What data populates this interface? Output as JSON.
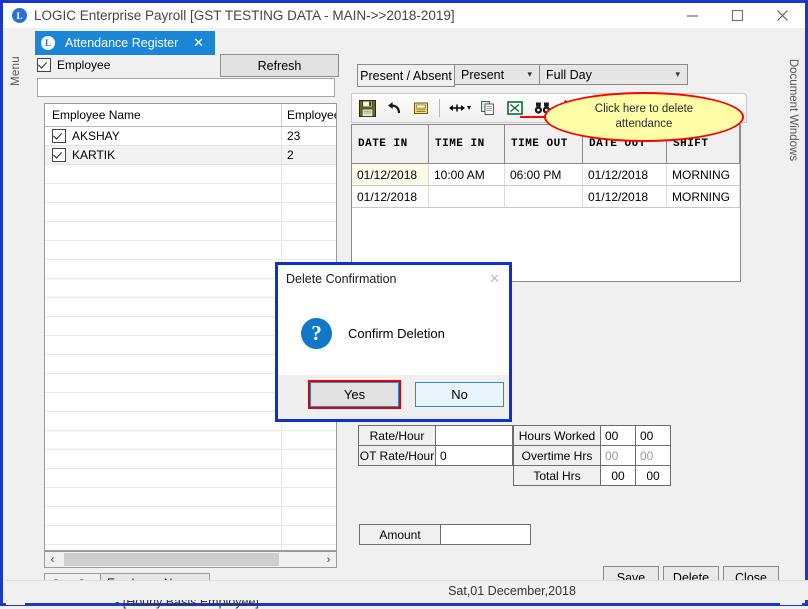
{
  "window": {
    "title": "LOGIC Enterprise Payroll  [GST TESTING DATA - MAIN->>2018-2019]",
    "logo_letter": "L",
    "minimize_label": "Minimize",
    "maximize_label": "Maximize",
    "close_label": "Close"
  },
  "side_strips": {
    "menu_label": "Menu",
    "document_windows_label": "Document Windows"
  },
  "tab": {
    "label": "Attendance Register",
    "close_glyph": "✕",
    "logo_letter": "L"
  },
  "left_panel": {
    "employee_checkbox_label": "Employee",
    "employee_checked": true,
    "refresh_label": "Refresh",
    "search_value": "",
    "grid_headers": [
      "Employee Name",
      "Employee"
    ],
    "rows": [
      {
        "checked": true,
        "name": "AKSHAY",
        "code": "23"
      },
      {
        "checked": true,
        "name": "KARTIK",
        "code": "2"
      }
    ],
    "scroll_left_glyph": "‹",
    "scroll_right_glyph": "›",
    "sort_on_label": "Sort On",
    "sort_on_value": "Employee Name",
    "basis_note": "- [Hourly Basis Employee]"
  },
  "right_panel": {
    "present_absent_label": "Present / Absent",
    "present_absent_value": "Present",
    "day_type_value": "Full Day",
    "toolbar": [
      {
        "name": "save-icon",
        "title": "Save"
      },
      {
        "name": "undo-icon",
        "title": "Undo"
      },
      {
        "name": "notes-icon",
        "title": "Notes"
      },
      {
        "name": "resize-columns-icon",
        "title": "Resize Columns"
      },
      {
        "name": "copy-icon",
        "title": "Copy"
      },
      {
        "name": "export-excel-icon",
        "title": "Export to Excel"
      },
      {
        "name": "find-icon",
        "title": "Find"
      },
      {
        "name": "delete-icon",
        "title": "Delete"
      }
    ],
    "attendance_headers": [
      "DATE IN",
      "TIME IN",
      "TIME OUT",
      "DATE OUT",
      "SHIFT"
    ],
    "attendance_rows": [
      {
        "date_in": "01/12/2018",
        "time_in": "10:00 AM",
        "time_out": "06:00 PM",
        "date_out": "01/12/2018",
        "shift": "MORNING",
        "selected": true
      },
      {
        "date_in": "01/12/2018",
        "time_in": "",
        "time_out": "",
        "date_out": "01/12/2018",
        "shift": "MORNING",
        "selected": false
      }
    ],
    "rate_hour_label": "Rate/Hour",
    "rate_hour_value": "",
    "ot_rate_hour_label": "OT Rate/Hour",
    "ot_rate_hour_value": "0",
    "hours_worked_label": "Hours Worked",
    "hours_worked_h": "00",
    "hours_worked_m": "00",
    "overtime_hrs_label": "Overtime Hrs",
    "overtime_hrs_h": "00",
    "overtime_hrs_m": "00",
    "total_hrs_label": "Total Hrs",
    "total_hrs_h": "00",
    "total_hrs_m": "00",
    "amount_label": "Amount",
    "amount_value": "",
    "save_label": "Save",
    "delete_label": "Delete",
    "close_label": "Close"
  },
  "callout": {
    "line1": "Click here to delete",
    "line2": "attendance",
    "fill_color": "#ffffa8",
    "border_color": "#ff0000"
  },
  "dialog": {
    "title": "Delete Confirmation",
    "close_glyph": "✕",
    "icon_glyph": "?",
    "message": "Confirm Deletion",
    "yes_label": "Yes",
    "no_label": "No",
    "highlight_color": "#e00000"
  },
  "statusbar": {
    "date_text": "Sat,01 December,2018"
  }
}
